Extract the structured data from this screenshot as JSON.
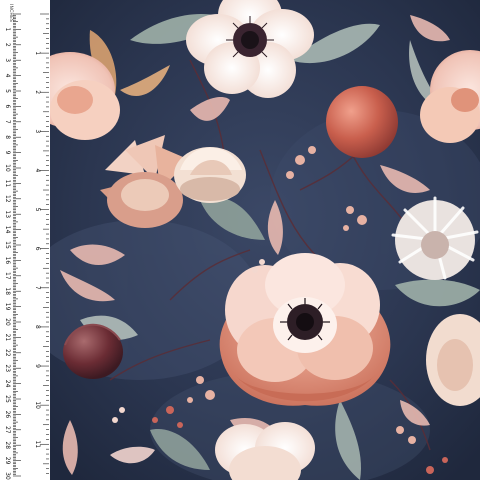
{
  "ruler": {
    "unit_label": "INCHES",
    "inch_numbers": [
      "1",
      "2",
      "3",
      "4",
      "5",
      "6",
      "7",
      "8",
      "9",
      "10",
      "11",
      "12"
    ],
    "cm_numbers": [
      "1",
      "2",
      "3",
      "4",
      "5",
      "6",
      "7",
      "8",
      "9",
      "10",
      "11",
      "12",
      "13",
      "14",
      "15",
      "16",
      "17",
      "18",
      "19",
      "20",
      "21",
      "22",
      "23",
      "24",
      "25",
      "26",
      "27",
      "28",
      "29",
      "30"
    ]
  },
  "artwork": {
    "subject": "watercolor floral pattern",
    "background_color": "#2b3650",
    "accent_colors": [
      "#f3d5cf",
      "#d87a68",
      "#b9524a",
      "#9fb0a8",
      "#6b2c34"
    ]
  }
}
